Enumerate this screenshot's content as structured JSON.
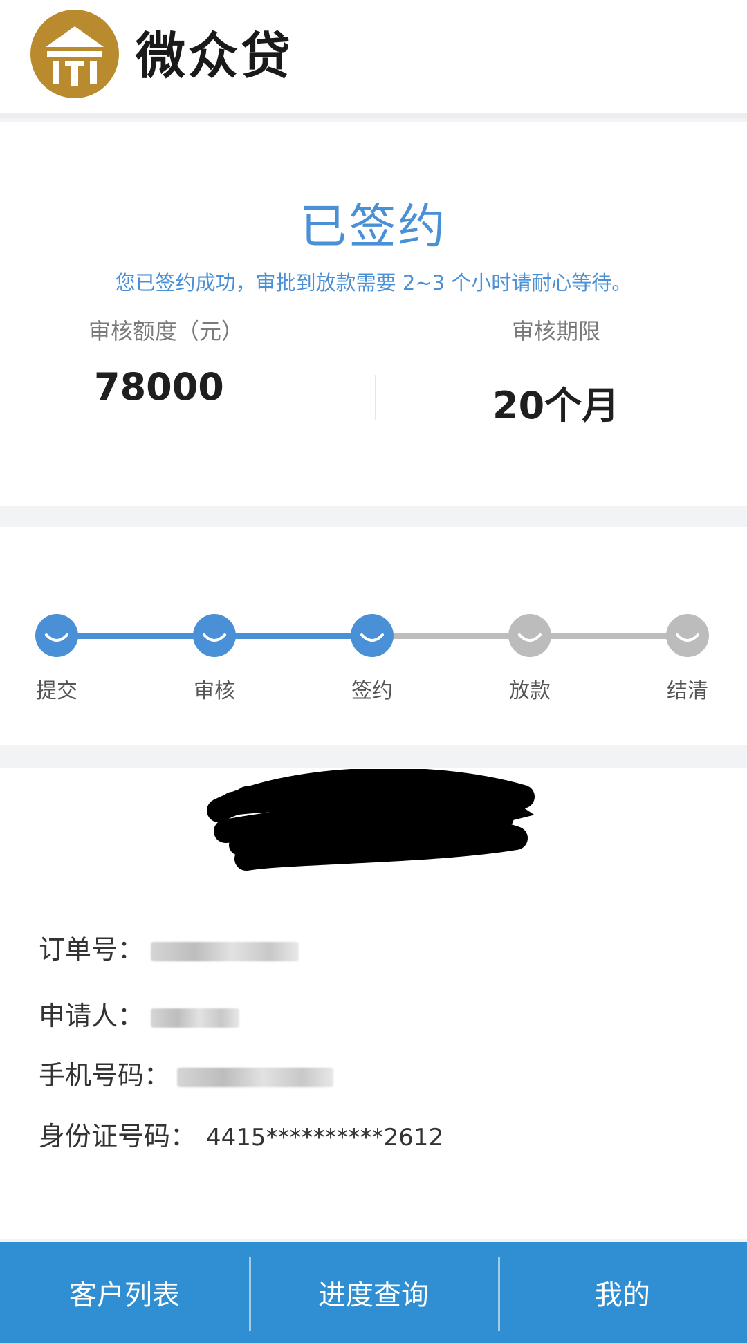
{
  "header": {
    "brand": "微众贷",
    "logo_icon": "pillar-gate-icon"
  },
  "summary": {
    "status": "已签约",
    "message": "您已签约成功，审批到放款需要 2~3 个小时请耐心等待。",
    "amount_label": "审核额度（元）",
    "amount_value": "78000",
    "term_label": "审核期限",
    "term_value": "20个月"
  },
  "progress": {
    "steps": [
      {
        "label": "提交",
        "done": true
      },
      {
        "label": "审核",
        "done": true
      },
      {
        "label": "签约",
        "done": true
      },
      {
        "label": "放款",
        "done": false
      },
      {
        "label": "结清",
        "done": false
      }
    ],
    "active_color": "#4a90d6",
    "inactive_color": "#bcbcbc"
  },
  "details": {
    "order_label": "订单号：",
    "applicant_label": "申请人：",
    "phone_label": "手机号码：",
    "id_label": "身份证号码：",
    "id_value": "4415**********2612"
  },
  "tabbar": {
    "tabs": [
      "客户列表",
      "进度查询",
      "我的"
    ],
    "color": "#2f8fd2"
  }
}
